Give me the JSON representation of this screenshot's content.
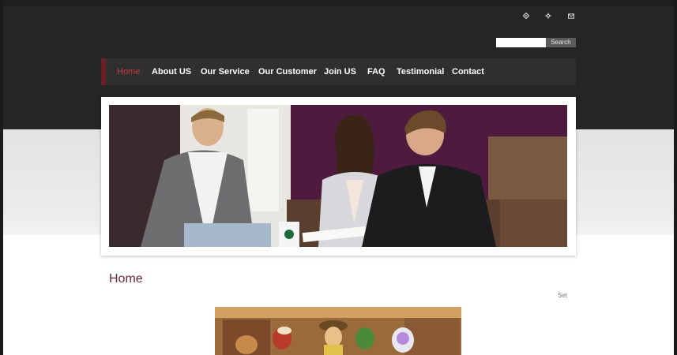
{
  "header": {
    "icons": [
      "home-icon",
      "sitemap-icon",
      "mail-icon"
    ],
    "search": {
      "value": "",
      "placeholder": "",
      "button_label": "Search"
    }
  },
  "nav": {
    "items": [
      {
        "label": "Home",
        "active": true
      },
      {
        "label": "About US",
        "active": false
      },
      {
        "label": "Our Service",
        "active": false
      },
      {
        "label": "Our Customer",
        "active": false
      },
      {
        "label": "Join US",
        "active": false
      },
      {
        "label": "FAQ",
        "active": false
      },
      {
        "label": "Testimonial",
        "active": false
      },
      {
        "label": "Contact",
        "active": false
      }
    ]
  },
  "content": {
    "title": "Home",
    "side_link": "Set"
  },
  "colors": {
    "header_bg": "#252525",
    "nav_bg": "#2f2f2f",
    "accent": "#c23a45",
    "title": "#6b2a33"
  }
}
